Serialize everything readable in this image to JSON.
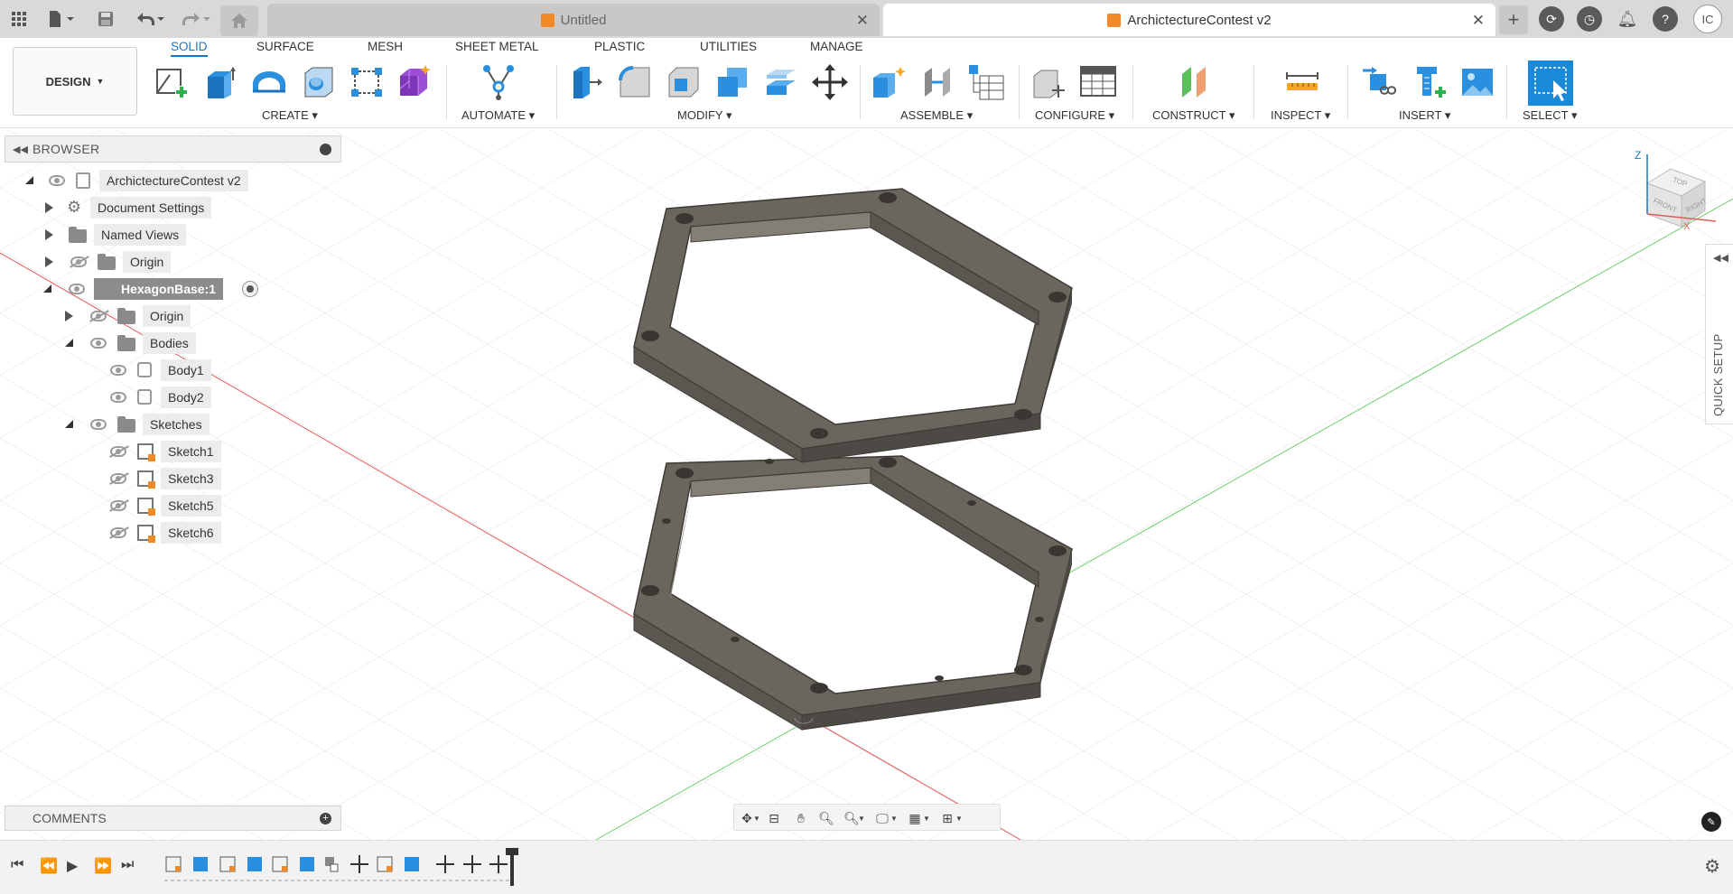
{
  "titlebar": {
    "tabs": [
      {
        "label": "Untitled",
        "active": false
      },
      {
        "label": "ArchictectureContest v2",
        "active": true
      }
    ],
    "user_initials": "IC"
  },
  "toolbar": {
    "workspace": "DESIGN",
    "workspace_tabs": [
      "SOLID",
      "SURFACE",
      "MESH",
      "SHEET METAL",
      "PLASTIC",
      "UTILITIES",
      "MANAGE"
    ],
    "active_tab": "SOLID",
    "groups": [
      "CREATE",
      "AUTOMATE",
      "MODIFY",
      "ASSEMBLE",
      "CONFIGURE",
      "CONSTRUCT",
      "INSPECT",
      "INSERT",
      "SELECT"
    ]
  },
  "browser": {
    "title": "BROWSER",
    "items": [
      {
        "label": "ArchictectureContest v2"
      },
      {
        "label": "Document Settings"
      },
      {
        "label": "Named Views"
      },
      {
        "label": "Origin"
      },
      {
        "label": "HexagonBase:1"
      },
      {
        "label": "Origin"
      },
      {
        "label": "Bodies"
      },
      {
        "label": "Body1"
      },
      {
        "label": "Body2"
      },
      {
        "label": "Sketches"
      },
      {
        "label": "Sketch1"
      },
      {
        "label": "Sketch3"
      },
      {
        "label": "Sketch5"
      },
      {
        "label": "Sketch6"
      }
    ]
  },
  "comments": {
    "title": "COMMENTS"
  },
  "quick_setup": {
    "label": "QUICK SETUP"
  },
  "viewcube": {
    "top": "TOP",
    "front": "FRONT",
    "right": "RIGHT",
    "axis_z": "Z",
    "axis_x": "X"
  },
  "colors": {
    "accent": "#1a73c9",
    "body": "#6b665d",
    "body_dark": "#4d4944",
    "body_light": "#847f76",
    "axis_x": "#e25c5c",
    "axis_y": "#6cd06c"
  }
}
